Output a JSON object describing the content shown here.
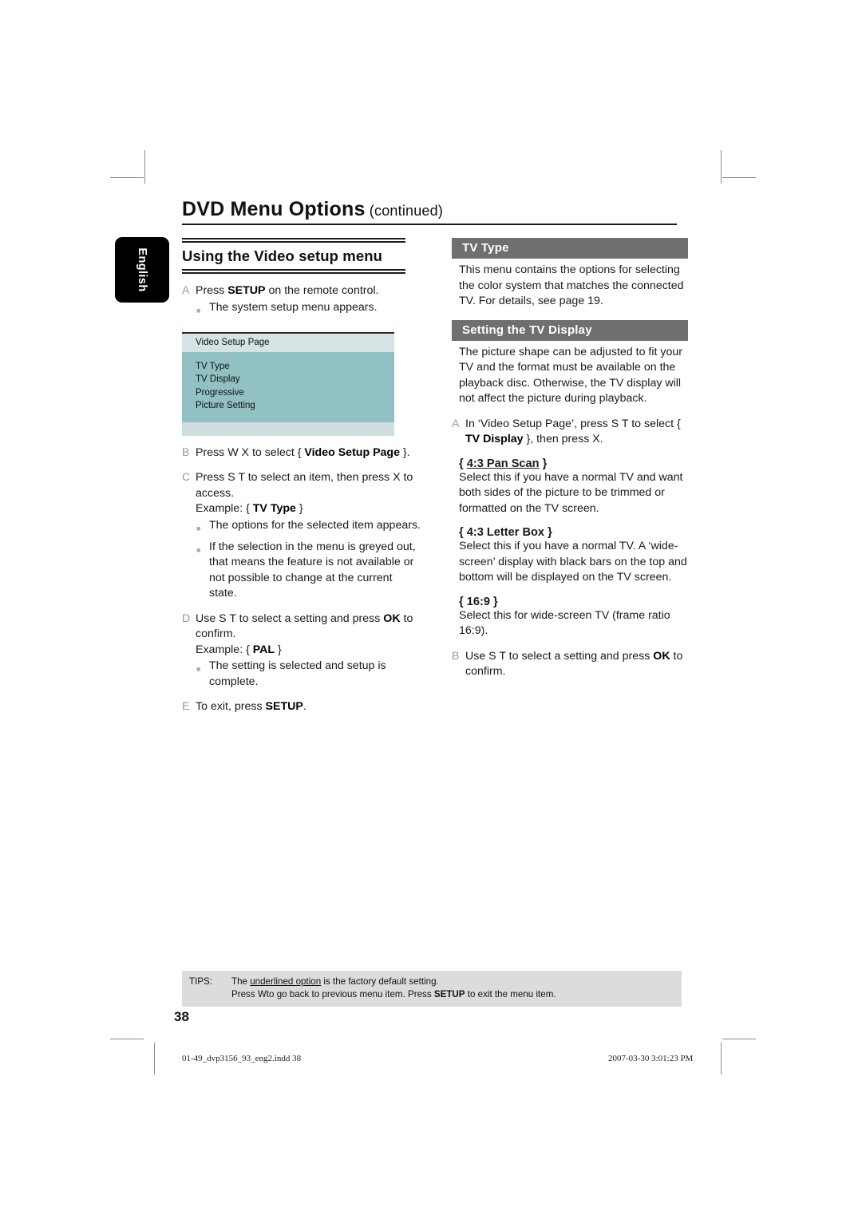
{
  "document": {
    "title_main": "DVD Menu Options",
    "title_continued": "(continued)",
    "language_tab": "English",
    "page_number": "38"
  },
  "left_column": {
    "section_heading": "Using the Video setup menu",
    "steps": [
      {
        "marker": "A",
        "text_before": "Press ",
        "bold": "SETUP",
        "text_after": " on the remote control."
      },
      {
        "marker": "B",
        "text_before": "Press  W X to select { ",
        "bold": "Video Setup Page",
        "text_after": " }."
      },
      {
        "marker": "C",
        "text_before": "Press  S  T to select an item, then press  X to access.",
        "bold": "",
        "text_after": ""
      },
      {
        "marker": "D",
        "text_before": "Use  S  T to select a setting and press ",
        "bold": "OK",
        "text_after": " to confirm."
      },
      {
        "marker": "E",
        "text_before": "To exit, press ",
        "bold": "SETUP",
        "text_after": "."
      }
    ],
    "bullet_a1": "The system setup menu appears.",
    "example_c_prefix": "Example: { ",
    "example_c_bold": "TV Type",
    "example_c_suffix": " }",
    "bullet_c1": "The options for the selected item appears.",
    "bullet_c2": "If the selection in the menu is greyed out, that means the feature is not available or not possible to change at the current state.",
    "example_d_prefix": "Example: { ",
    "example_d_bold": "PAL",
    "example_d_suffix": " }",
    "bullet_d1": "The setting is selected and setup is complete.",
    "menu_screenshot": {
      "title": "Video Setup Page",
      "items": [
        "TV Type",
        "TV Display",
        "Progressive",
        "Picture Setting"
      ],
      "colors": {
        "title_bg": "#d6e2e3",
        "body_bg": "#91c1c3",
        "foot_bg": "#cfdee0"
      }
    }
  },
  "right_column": {
    "tv_type": {
      "heading": "TV Type",
      "paragraph": "This menu contains the options for selecting the color system that matches the connected TV. For details, see page 19."
    },
    "tv_display": {
      "heading": "Setting the TV Display",
      "paragraph": "The picture shape can be adjusted to fit your TV and the format must be available on the playback disc. Otherwise, the TV display will not affect the picture during playback.",
      "step_a": {
        "marker": "A",
        "text_before": "In ‘Video Setup Page’, press  S  T to select { ",
        "bold": "TV Display",
        "text_after": " }, then press  X."
      },
      "options": [
        {
          "name": "4:3 Pan Scan",
          "underlined": true,
          "description": "Select this if you have a normal TV and want both sides of the picture to be trimmed or formatted on the TV screen."
        },
        {
          "name": "4:3 Letter Box",
          "underlined": false,
          "description": "Select this if you have a normal TV. A ‘wide-screen’ display with black bars on the top and bottom will be displayed on the TV screen."
        },
        {
          "name": "16:9",
          "underlined": false,
          "description": "Select this for wide-screen TV (frame ratio 16:9)."
        }
      ],
      "step_b": {
        "marker": "B",
        "text_before": "Use  S  T to select a setting and press ",
        "bold": "OK",
        "text_after": " to confirm."
      }
    }
  },
  "tips": {
    "label": "TIPS:",
    "line1_before": "The ",
    "line1_underlined": "underlined option",
    "line1_after": " is the factory default setting.",
    "line2_before": "Press   Wto go back to previous menu item. Press ",
    "line2_bold": "SETUP",
    "line2_after": " to exit the menu item."
  },
  "footer": {
    "file_name": "01-49_dvp3156_93_eng2.indd   38",
    "timestamp": "2007-03-30   3:01:23 PM"
  }
}
